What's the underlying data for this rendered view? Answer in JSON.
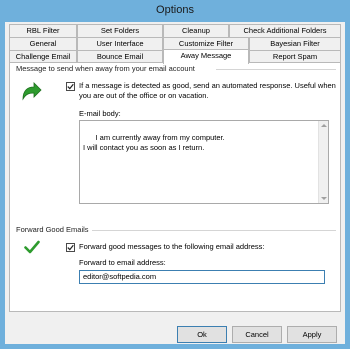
{
  "window": {
    "title": "Options"
  },
  "tabs": {
    "row1": [
      "RBL Filter",
      "Set Folders",
      "Cleanup",
      "Check Additional Folders"
    ],
    "row2": [
      "General",
      "User Interface",
      "Customize Filter",
      "Bayesian Filter"
    ],
    "row3": [
      "Challenge Email",
      "Bounce Email",
      "Away Message",
      "Report Spam"
    ],
    "active": "Away Message"
  },
  "away_group": {
    "title": "Message to send when away from your email account",
    "checkbox_label": "If a message is detected as good, send an automated response. Useful when you are out of the office or on vacation.",
    "checked": true,
    "email_body_label": "E-mail body:",
    "email_body": "I am currently away from my computer.\nI will contact you as soon as I return."
  },
  "forward_group": {
    "title": "Forward Good Emails",
    "checkbox_label": "Forward good messages to the following email address:",
    "checked": true,
    "address_label": "Forward to email address:",
    "address_value": "editor@softpedia.com"
  },
  "buttons": {
    "ok": "Ok",
    "cancel": "Cancel",
    "apply": "Apply"
  },
  "icons": {
    "arrow": "green-reply-arrow-icon",
    "check": "green-checkmark-icon"
  },
  "colors": {
    "titlebar": "#6fb0dc",
    "accent": "#3c7fb1",
    "icon_green": "#2e9b2e"
  }
}
